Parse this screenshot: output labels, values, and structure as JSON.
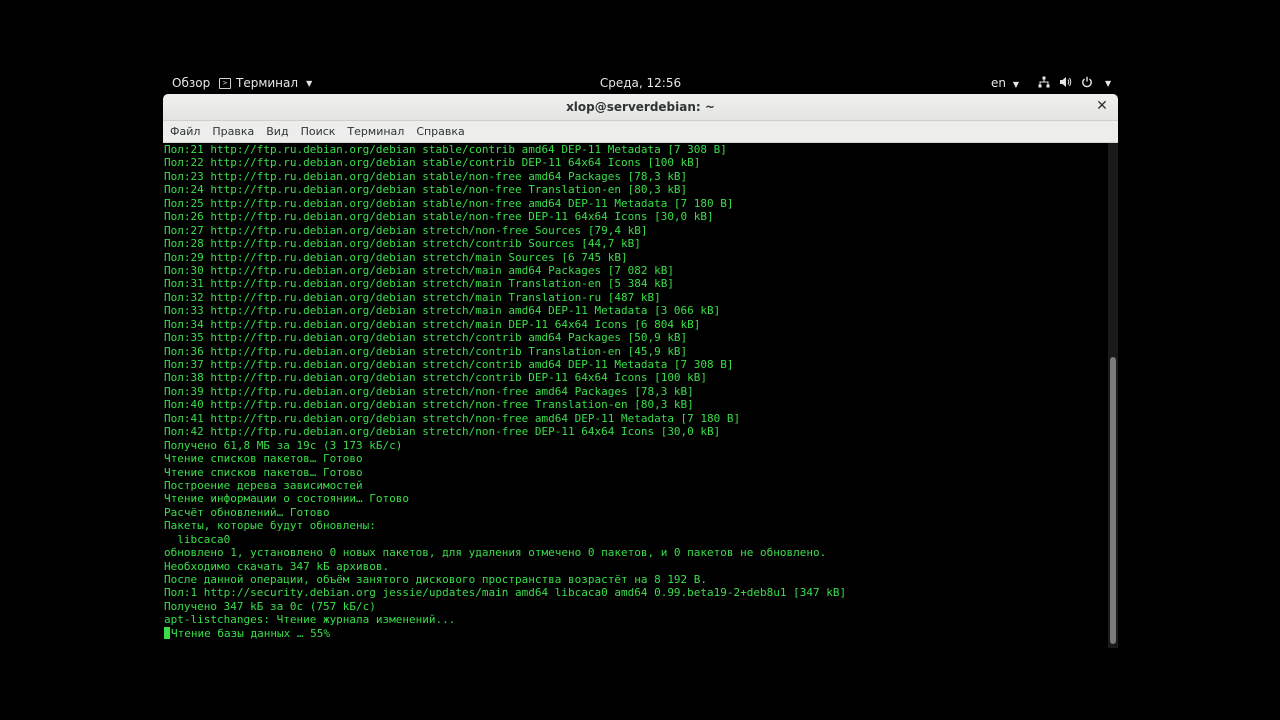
{
  "topbar": {
    "overview": "Обзор",
    "app_name": "Терминал",
    "clock": "Среда, 12:56",
    "lang": "en"
  },
  "window": {
    "title": "xlop@serverdebian: ~"
  },
  "menu": [
    "Файл",
    "Правка",
    "Вид",
    "Поиск",
    "Терминал",
    "Справка"
  ],
  "terminal": {
    "lines": [
      "Пол:21 http://ftp.ru.debian.org/debian stable/contrib amd64 DEP-11 Metadata [7 308 B]",
      "Пол:22 http://ftp.ru.debian.org/debian stable/contrib DEP-11 64x64 Icons [100 kB]",
      "Пол:23 http://ftp.ru.debian.org/debian stable/non-free amd64 Packages [78,3 kB]",
      "Пол:24 http://ftp.ru.debian.org/debian stable/non-free Translation-en [80,3 kB]",
      "Пол:25 http://ftp.ru.debian.org/debian stable/non-free amd64 DEP-11 Metadata [7 180 B]",
      "Пол:26 http://ftp.ru.debian.org/debian stable/non-free DEP-11 64x64 Icons [30,0 kB]",
      "Пол:27 http://ftp.ru.debian.org/debian stretch/non-free Sources [79,4 kB]",
      "Пол:28 http://ftp.ru.debian.org/debian stretch/contrib Sources [44,7 kB]",
      "Пол:29 http://ftp.ru.debian.org/debian stretch/main Sources [6 745 kB]",
      "Пол:30 http://ftp.ru.debian.org/debian stretch/main amd64 Packages [7 082 kB]",
      "Пол:31 http://ftp.ru.debian.org/debian stretch/main Translation-en [5 384 kB]",
      "Пол:32 http://ftp.ru.debian.org/debian stretch/main Translation-ru [487 kB]",
      "Пол:33 http://ftp.ru.debian.org/debian stretch/main amd64 DEP-11 Metadata [3 066 kB]",
      "Пол:34 http://ftp.ru.debian.org/debian stretch/main DEP-11 64x64 Icons [6 804 kB]",
      "Пол:35 http://ftp.ru.debian.org/debian stretch/contrib amd64 Packages [50,9 kB]",
      "Пол:36 http://ftp.ru.debian.org/debian stretch/contrib Translation-en [45,9 kB]",
      "Пол:37 http://ftp.ru.debian.org/debian stretch/contrib amd64 DEP-11 Metadata [7 308 B]",
      "Пол:38 http://ftp.ru.debian.org/debian stretch/contrib DEP-11 64x64 Icons [100 kB]",
      "Пол:39 http://ftp.ru.debian.org/debian stretch/non-free amd64 Packages [78,3 kB]",
      "Пол:40 http://ftp.ru.debian.org/debian stretch/non-free Translation-en [80,3 kB]",
      "Пол:41 http://ftp.ru.debian.org/debian stretch/non-free amd64 DEP-11 Metadata [7 180 B]",
      "Пол:42 http://ftp.ru.debian.org/debian stretch/non-free DEP-11 64x64 Icons [30,0 kB]",
      "Получено 61,8 MБ за 19c (3 173 kБ/c)",
      "Чтение списков пакетов… Готово",
      "Чтение списков пакетов… Готово",
      "Построение дерева зависимостей",
      "Чтение информации о состоянии… Готово",
      "Расчёт обновлений… Готово",
      "Пакеты, которые будут обновлены:",
      "  libcaca0",
      "обновлено 1, установлено 0 новых пакетов, для удаления отмечено 0 пакетов, и 0 пакетов не обновлено.",
      "Необходимо скачать 347 kБ архивов.",
      "После данной операции, объём занятого дискового пространства возрастёт на 8 192 B.",
      "Пол:1 http://security.debian.org jessie/updates/main amd64 libcaca0 amd64 0.99.beta19-2+deb8u1 [347 kB]",
      "Получено 347 kБ за 0c (757 kБ/c)",
      "apt-listchanges: Чтение журнала изменений...",
      "Чтение базы данных … 55%"
    ]
  },
  "icons": {
    "terminal": "terminal-icon",
    "network": "network-icon",
    "volume": "volume-icon",
    "power": "power-icon",
    "close": "close-icon"
  }
}
